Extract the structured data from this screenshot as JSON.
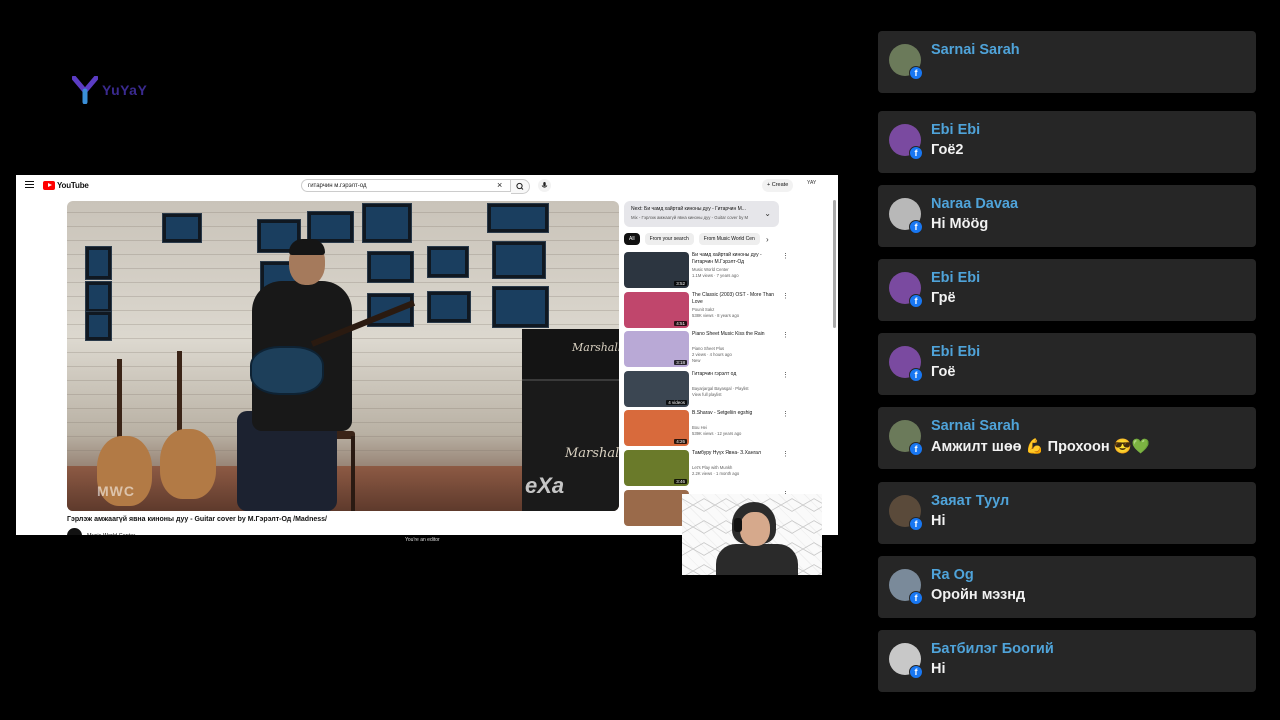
{
  "channel_logo": {
    "text": "YuYaY"
  },
  "browser": {
    "app_name": "YouTube",
    "search_query": "гитарчин м.гэрэлт-од",
    "create_label": "Create",
    "avatar_label": "YAY",
    "video_title": "Гэрлэж амжаагүй явна киноны дуу - Guitar cover by М.Гэрэлт-Од /Madness/",
    "channel_name": "Music World Center",
    "watermark_left": "MWC",
    "watermark_right": "eXa",
    "amp_brand": "Marshall",
    "editor_note": "You're an editor",
    "next_up": {
      "title": "Next: Би чамд хайртай киноны дуу - Гитарчин М...",
      "subtitle": "Mix - Гэрлэж амжаагүй явна киноны дуу - Guitar cover by M"
    },
    "chips": [
      "All",
      "From your search",
      "From Music World Cen"
    ],
    "recommendations": [
      {
        "title": "Би чамд хайртай киноны дуу - Гитарчин М.Гэрэлт-Од",
        "channel": "Music World Center",
        "meta": "1.1M views · 7 years ago",
        "duration": "3:52",
        "thumb": "#2c3540"
      },
      {
        "title": "The Classic (2003) OST - More Than Love",
        "channel": "Pounit Sakz",
        "meta": "538K views · 8 years ago",
        "duration": "4:51",
        "thumb": "#c0466c"
      },
      {
        "title": "Piano Sheet Music Kiss the Rain",
        "channel": "Piano Sheet Plus",
        "meta": "2 views · 4 hours ago",
        "extra": "New",
        "duration": "3:18",
        "thumb": "#b9a9d6"
      },
      {
        "title": "Гитарчин гэрэлт од",
        "channel": "Bayarjargal Bayasgal · Playlist",
        "meta": "View full playlist",
        "duration": "4 videos",
        "thumb": "#3b4652"
      },
      {
        "title": "B.Sharav - Setgeliin egshig",
        "channel": "Bou Hei",
        "meta": "539K views · 12 years ago",
        "duration": "4:26",
        "thumb": "#d86a3c"
      },
      {
        "title": "Тамбуру Нүүх Явна- З.Хангал",
        "channel": "Let's Play with Munkh",
        "meta": "2.2K views · 1 month ago",
        "duration": "3:46",
        "thumb": "#6a7a2a"
      },
      {
        "title": "",
        "channel": "",
        "meta": "",
        "duration": "",
        "thumb": "#9a6a4a"
      }
    ]
  },
  "comments": [
    {
      "name": "Sarnai Sarah",
      "text": "",
      "avatar_color": "#6b7a5a"
    },
    {
      "name": "Ebi Ebi",
      "text": "Гоё2",
      "avatar_color": "#7a4aa0"
    },
    {
      "name": "Naraa Davaa",
      "text": "Hi Möög",
      "avatar_color": "#b8b8b8"
    },
    {
      "name": "Ebi Ebi",
      "text": "Грё",
      "avatar_color": "#7a4aa0"
    },
    {
      "name": "Ebi Ebi",
      "text": "Гоё",
      "avatar_color": "#7a4aa0"
    },
    {
      "name": "Sarnai Sarah",
      "text": "Амжилт шөө 💪 Прохоон 😎💚",
      "avatar_color": "#6b7a5a"
    },
    {
      "name": "Заяат Туул",
      "text": "Hi",
      "avatar_color": "#5a4a3a"
    },
    {
      "name": "Ra Og",
      "text": "Оройн мэзнд",
      "avatar_color": "#7a8a9a"
    },
    {
      "name": "Батбилэг Боогий",
      "text": "Hi",
      "avatar_color": "#c8c8c8"
    }
  ],
  "colors": {
    "name": "#4fa3d9",
    "card": "#262626",
    "facebook": "#1877f2"
  }
}
